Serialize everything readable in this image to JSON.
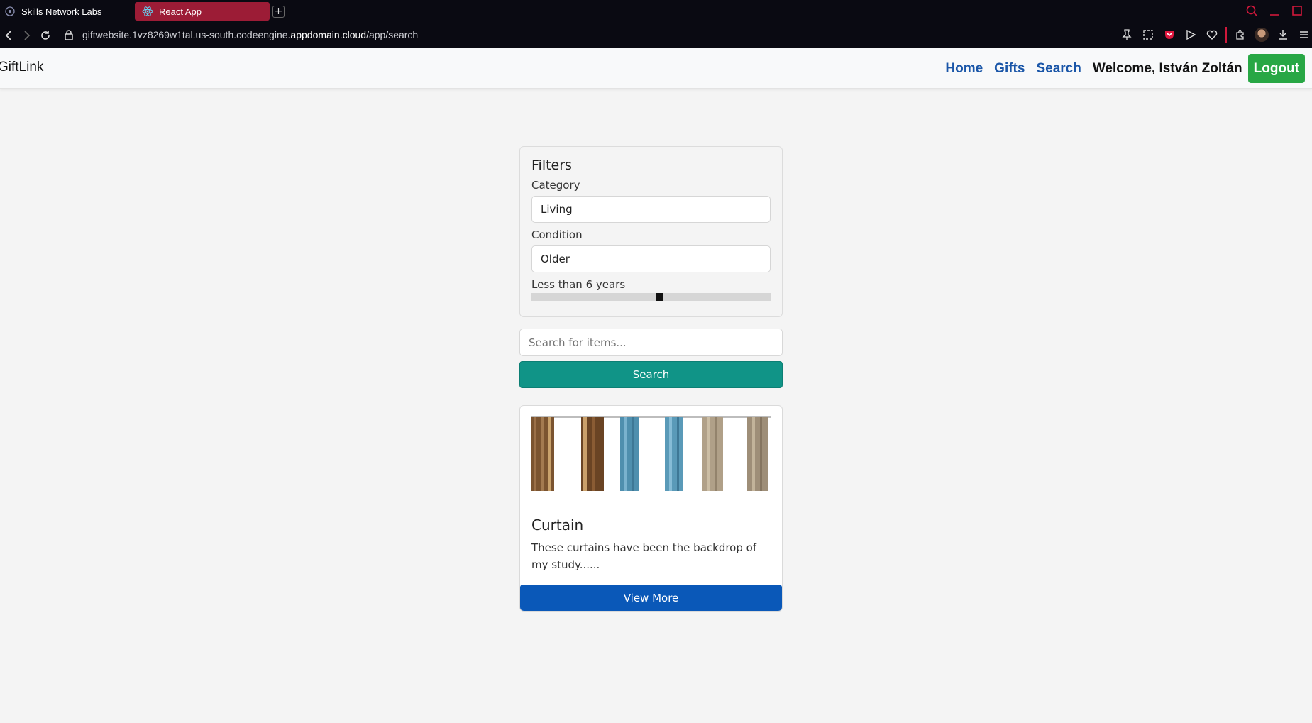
{
  "browser": {
    "tabs": [
      {
        "title": "Skills Network Labs",
        "icon": "skills-network-icon"
      },
      {
        "title": "React App",
        "icon": "react-icon",
        "active": true
      }
    ],
    "new_tab": "+",
    "url_prefix": "giftwebsite.1vz8269w1tal.us-south.codeengine.",
    "url_domain": "appdomain.cloud",
    "url_path": "/app/search",
    "accent_color": "#9c1c36"
  },
  "navbar": {
    "brand": "GiftLink",
    "links": [
      "Home",
      "Gifts",
      "Search"
    ],
    "welcome": "Welcome, István Zoltán",
    "logout_label": "Logout",
    "link_color": "#1a56a8",
    "logout_color": "#28a745"
  },
  "filters": {
    "title": "Filters",
    "category_label": "Category",
    "category_value": "Living",
    "condition_label": "Condition",
    "condition_value": "Older",
    "age_label": "Less than 6 years",
    "age_value": 6
  },
  "search": {
    "placeholder": "Search for items...",
    "button_label": "Search",
    "button_color": "#109487"
  },
  "results": [
    {
      "title": "Curtain",
      "description": "These curtains have been the backdrop of my study......",
      "button_label": "View More"
    }
  ]
}
